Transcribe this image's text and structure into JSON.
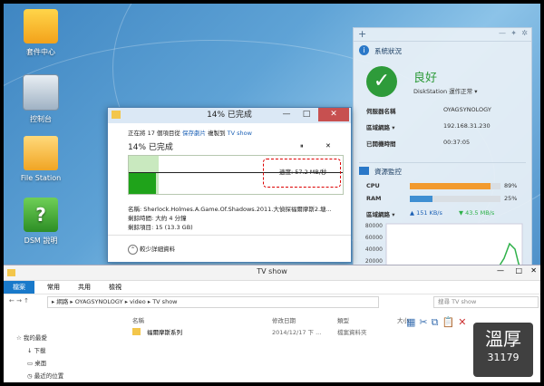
{
  "desktop": {
    "icons": [
      {
        "label": "套件中心"
      },
      {
        "label": "控制台"
      },
      {
        "label": "File Station"
      },
      {
        "label": "DSM 說明"
      }
    ]
  },
  "copy_dialog": {
    "window_title": "14% 已完成",
    "copying_prefix": "正在將 17 個項目從",
    "source": "保存劇片",
    "copying_mid": "複製到",
    "destination": "TV show",
    "percent_text": "14% 已完成",
    "pause": "⏸",
    "close": "✕",
    "speed": "速度: 57.2 MB/秒",
    "progress": 0.14,
    "name_label": "名稱: Sherlock.Holmes.A.Game.Of.Shadows.2011.大偵探福爾摩斯2.塘...",
    "remaining_time": "剩餘時間: 大約 4 分鐘",
    "remaining_items": "剩餘項目: 15 (13.3 GB)",
    "fewer_details": "較少詳細資料"
  },
  "sys_panel": {
    "status_title": "系統狀況",
    "status_value": "良好",
    "status_sub": "DiskStation 運作正常",
    "server_name_label": "伺服器名稱",
    "server_name": "OYAGSYNOLOGY",
    "lan_label": "區域網路",
    "lan_ip": "192.168.31.230",
    "uptime_label": "已開機時間",
    "uptime": "00:37:05",
    "monitor_title": "資源監控",
    "cpu_label": "CPU",
    "cpu_value": "89%",
    "cpu_frac": 0.89,
    "ram_label": "RAM",
    "ram_value": "25%",
    "ram_frac": 0.25,
    "lan_label2": "區域網路",
    "upload": "151 KB/s",
    "download": "43.5 MB/s",
    "y_ticks": [
      "80000",
      "60000",
      "40000",
      "20000",
      "0"
    ],
    "colors": {
      "cpu": "#f29a2e",
      "ram": "#3f8fd2",
      "ok": "#2e9b3a",
      "down": "#2fb14a"
    }
  },
  "explorer": {
    "title": "TV show",
    "ribbon_tabs": [
      "檔案",
      "常用",
      "共用",
      "檢視"
    ],
    "path": [
      "網路",
      "OYAGSYNOLOGY",
      "video",
      "TV show"
    ],
    "search_placeholder": "搜尋 TV show",
    "col_name": "名稱",
    "col_date": "修改日期",
    "col_type": "類型",
    "col_size": "大小",
    "nav_favorites": "我的最愛",
    "nav_download": "下載",
    "nav_desktop": "桌面",
    "nav_recent": "最近的位置",
    "rows": [
      {
        "name": "福爾摩斯系列",
        "date": "2014/12/17 下 ...",
        "type": "檔案資料夾"
      }
    ]
  },
  "watermark": {
    "line1": "溫厚",
    "line2": "31179"
  }
}
